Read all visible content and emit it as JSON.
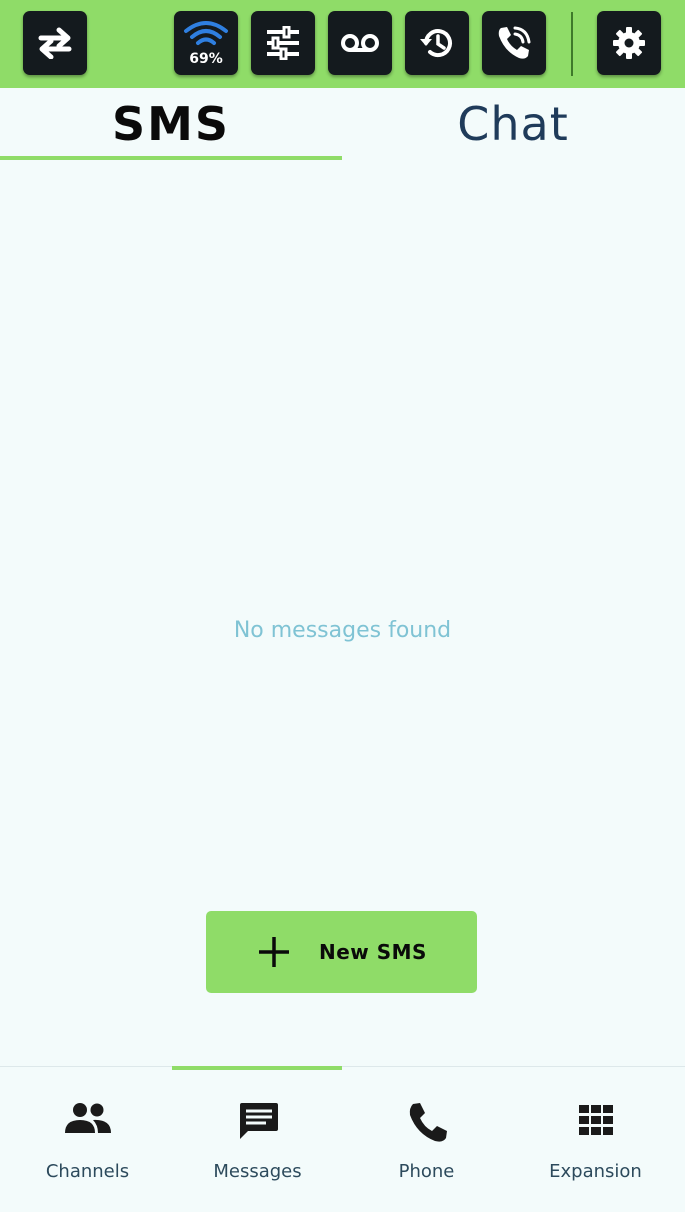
{
  "topbar": {
    "buttons": [
      {
        "name": "swap-icon"
      },
      {
        "name": "wifi-icon",
        "badge": "69%"
      },
      {
        "name": "sliders-icon"
      },
      {
        "name": "voicemail-icon"
      },
      {
        "name": "history-icon"
      },
      {
        "name": "phone-wifi-icon"
      },
      {
        "name": "gear-icon"
      }
    ],
    "wifi_percent": "69%"
  },
  "tabs": {
    "sms": "SMS",
    "chat": "Chat",
    "active": "SMS"
  },
  "main": {
    "empty_message": "No messages found"
  },
  "fab": {
    "icon": "plus-icon",
    "label": "New SMS"
  },
  "bottom_nav": {
    "active": "Messages",
    "items": [
      {
        "label": "Channels",
        "icon": "people-icon"
      },
      {
        "label": "Messages",
        "icon": "message-icon"
      },
      {
        "label": "Phone",
        "icon": "phone-icon"
      },
      {
        "label": "Expansion",
        "icon": "grid-icon"
      }
    ]
  },
  "colors": {
    "accent": "#8fdc68",
    "button_dark": "#141a1e",
    "background": "#f3fbfb",
    "empty_text": "#7fc3d4"
  }
}
